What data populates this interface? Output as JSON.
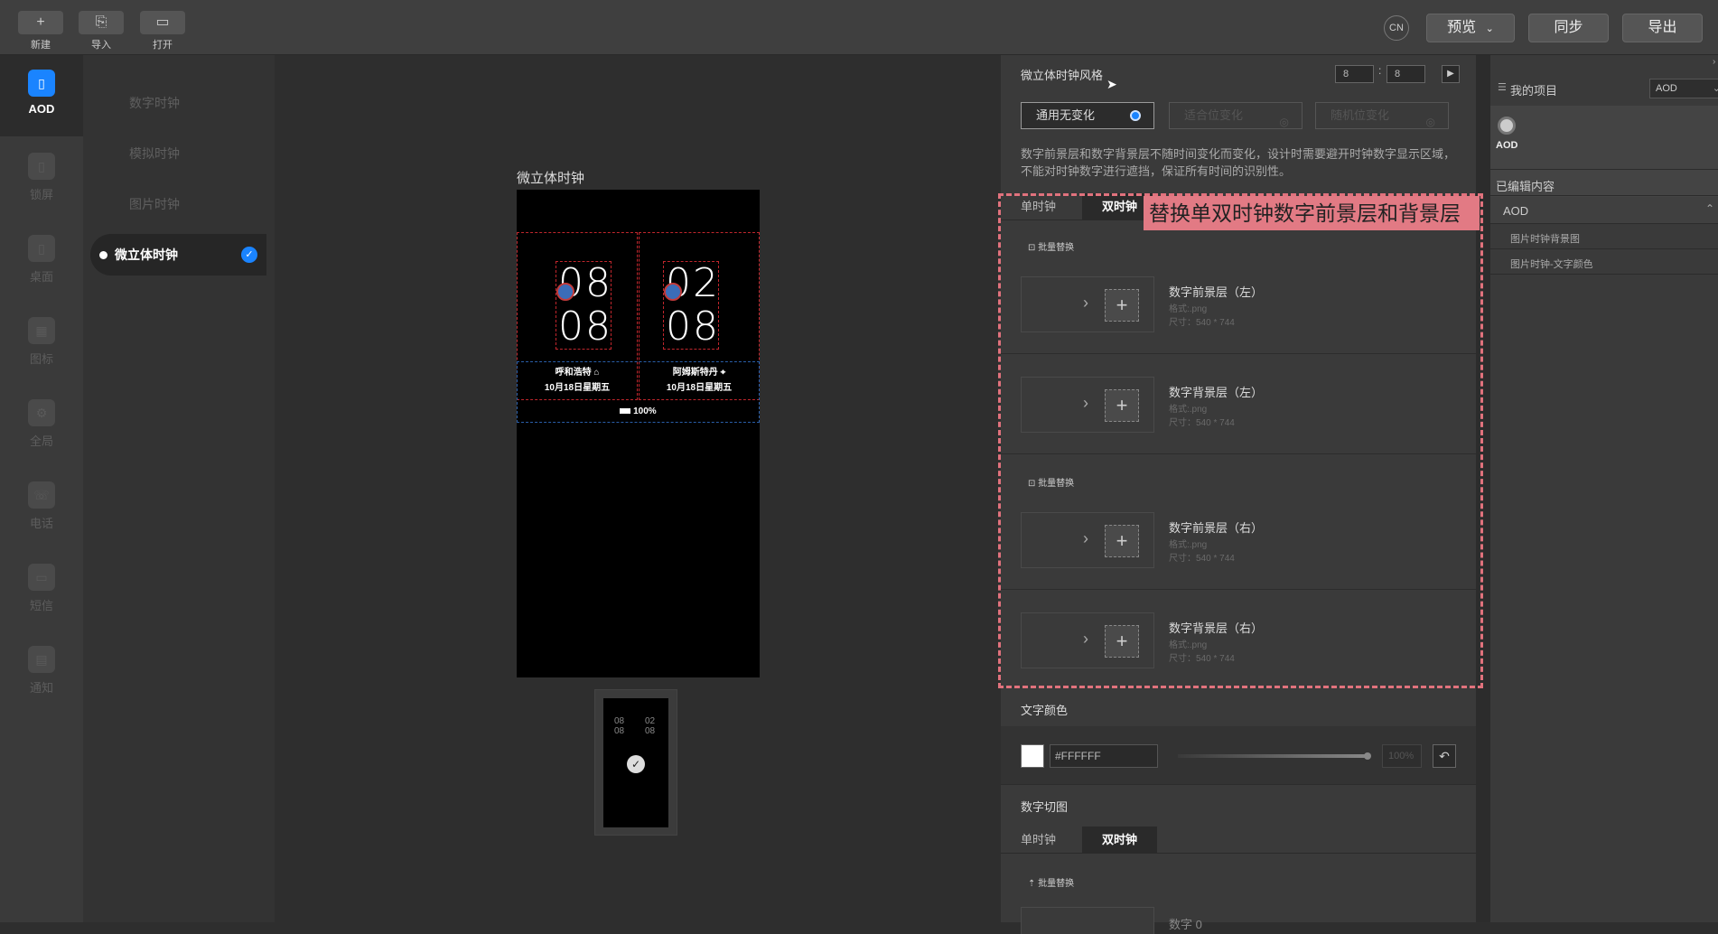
{
  "toolbar": {
    "new_label": "新建",
    "import_label": "导入",
    "open_label": "打开",
    "lang_label": "CN",
    "preview_label": "预览",
    "sync_label": "同步",
    "export_label": "导出"
  },
  "leftnav": {
    "items": [
      {
        "label": "AOD"
      },
      {
        "label": "锁屏"
      },
      {
        "label": "桌面"
      },
      {
        "label": "图标"
      },
      {
        "label": "全局"
      },
      {
        "label": "电话"
      },
      {
        "label": "短信"
      },
      {
        "label": "通知"
      }
    ]
  },
  "subnav": {
    "items": [
      {
        "label": "数字时钟"
      },
      {
        "label": "模拟时钟"
      },
      {
        "label": "图片时钟"
      },
      {
        "label": "微立体时钟"
      }
    ]
  },
  "canvas": {
    "phone_title": "微立体时钟",
    "left_clock": {
      "top": "08",
      "bottom": "08",
      "city": "呼和浩特",
      "date": "10月18日星期五"
    },
    "right_clock": {
      "top": "02",
      "bottom": "08",
      "city": "阿姆斯特丹",
      "date": "10月18日星期五"
    },
    "battery": "100%",
    "thumb": {
      "left_top": "08",
      "left_bottom": "08",
      "right_top": "02",
      "right_bottom": "08"
    }
  },
  "props": {
    "style_title": "微立体时钟风格",
    "time_h": "8",
    "time_sep": ":",
    "time_m": "8",
    "options": [
      "通用无变化",
      "适合位变化",
      "随机位变化"
    ],
    "description": "数字前景层和数字背景层不随时间变化而变化，设计时需要避开时钟数字显示区域，不能对时钟数字进行遮挡，保证所有时间的识别性。",
    "tabs": [
      "单时钟",
      "双时钟"
    ],
    "batch_label": "批量替换",
    "slots": [
      {
        "title": "数字前景层（左）",
        "format": "格式:.png",
        "size": "尺寸：540 * 744"
      },
      {
        "title": "数字背景层（左）",
        "format": "格式:.png",
        "size": "尺寸：540 * 744"
      },
      {
        "title": "数字前景层（右）",
        "format": "格式:.png",
        "size": "尺寸：540 * 744"
      },
      {
        "title": "数字背景层（右）",
        "format": "格式:.png",
        "size": "尺寸：540 * 744"
      }
    ],
    "text_color_title": "文字颜色",
    "color_value": "#FFFFFF",
    "opacity_value": "100%",
    "digit_cut_title": "数字切图",
    "digit_slot_title": "数字 0",
    "annotation": "替换单双时钟数字前景层和背景层"
  },
  "project": {
    "title": "我的项目",
    "dropdown": "AOD",
    "item_label": "AOD",
    "edited_title": "已编辑内容",
    "group": "AOD",
    "entries": [
      "图片时钟背景图",
      "图片时钟-文字颜色"
    ]
  }
}
